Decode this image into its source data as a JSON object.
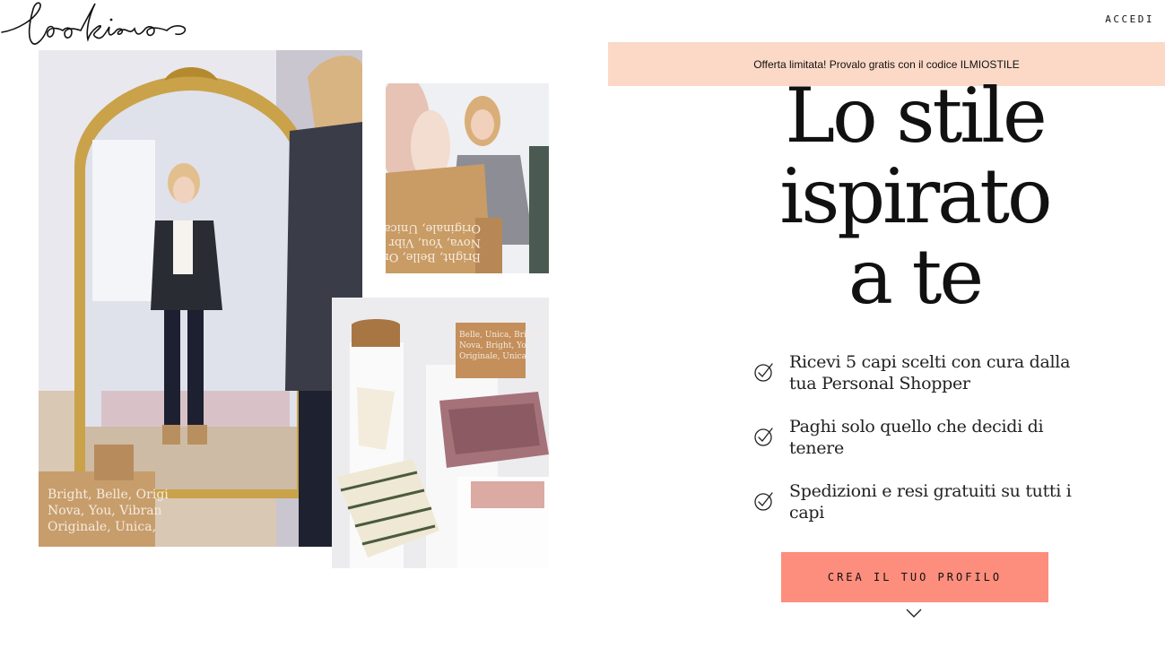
{
  "brand": {
    "name": "Lookiero",
    "logo_text": "lookiero"
  },
  "header": {
    "login_label": "ACCEDI"
  },
  "promo": {
    "text": "Offerta limitata! Provalo gratis con il codice ILMIOSTILE",
    "background": "#fcd9c7"
  },
  "hero": {
    "headline_lines": [
      "Lo stile",
      "ispirato",
      "a te"
    ],
    "benefits": [
      {
        "icon": "check-circle-icon",
        "text": "Ricevi 5 capi scelti con cura dalla tua Personal Shopper"
      },
      {
        "icon": "check-circle-icon",
        "text": "Paghi solo quello che decidi di tenere"
      },
      {
        "icon": "check-circle-icon",
        "text": "Spedizioni e resi gratuiti su tutti i capi"
      }
    ],
    "cta_label": "CREA IL TUO PROFILO",
    "cta_color": "#fd8d7c",
    "scroll_icon": "chevron-down-icon"
  },
  "photos": {
    "mirror_box_text": "Bright, Belle, Origi Nova, You, Vibran Originale, Unica,",
    "small_box_text": "Bright, Belle, Ori Nova, You, Vibr Originale, Unica",
    "flatlay_box_text": "Belle, Unica, Bright, Nova, Bright, You Originale, Unica"
  }
}
